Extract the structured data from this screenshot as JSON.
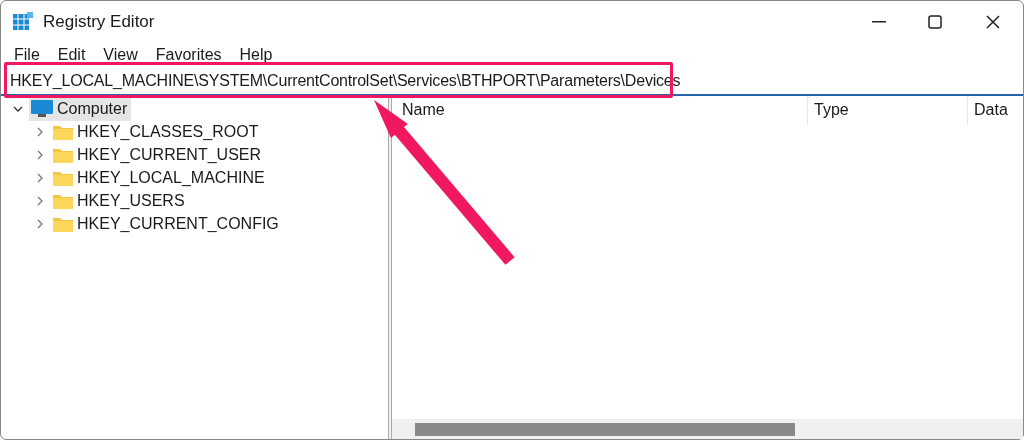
{
  "window": {
    "title": "Registry Editor"
  },
  "menu": [
    "File",
    "Edit",
    "View",
    "Favorites",
    "Help"
  ],
  "address": {
    "value": "HKEY_LOCAL_MACHINE\\SYSTEM\\CurrentControlSet\\Services\\BTHPORT\\Parameters\\Devices",
    "highlighted": true
  },
  "tree": [
    {
      "label": "Computer",
      "selected": true,
      "expanded": true,
      "children": [
        {
          "label": "HKEY_CLASSES_ROOT",
          "selected": false,
          "expanded": false
        },
        {
          "label": "HKEY_CURRENT_USER",
          "selected": false,
          "expanded": false
        },
        {
          "label": "HKEY_LOCAL_MACHINE",
          "selected": false,
          "expanded": false
        },
        {
          "label": "HKEY_USERS",
          "selected": false,
          "expanded": false
        },
        {
          "label": "HKEY_CURRENT_CONFIG",
          "selected": false,
          "expanded": false
        }
      ]
    }
  ],
  "table": {
    "columns": [
      "Name",
      "Type",
      "Data"
    ]
  }
}
